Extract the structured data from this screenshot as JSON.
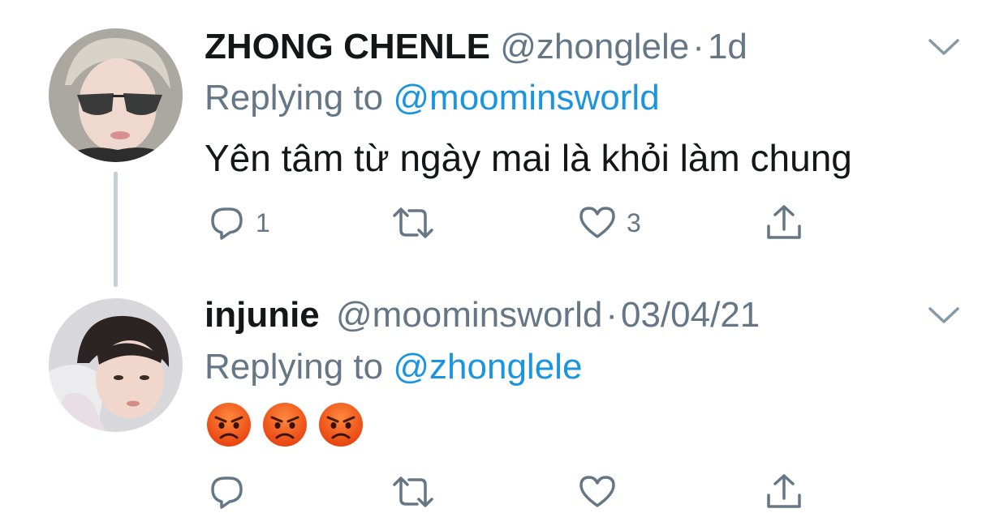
{
  "colors": {
    "text_primary": "#14171a",
    "text_secondary": "#657786",
    "link": "#1b95e0",
    "thread_line": "#c4cfd6"
  },
  "tweets": [
    {
      "display_name": "ZHONG CHENLE",
      "handle": "@zhonglele",
      "separator": "·",
      "time": "1d",
      "replying_prefix": "Replying to",
      "replying_to": "@moominsworld",
      "text": "Yên tâm từ ngày mai là khỏi làm chung",
      "reply_count": "1",
      "retweet_count": "",
      "like_count": "3",
      "avatar_icon": "user-avatar-photo"
    },
    {
      "display_name": "injunie",
      "handle": "@moominsworld",
      "separator": "·",
      "time": "03/04/21",
      "replying_prefix": "Replying to",
      "replying_to": "@zhonglele",
      "emojis": [
        "angry-face-emoji",
        "angry-face-emoji",
        "angry-face-emoji"
      ],
      "reply_count": "",
      "retweet_count": "",
      "like_count": "",
      "avatar_icon": "user-avatar-photo"
    }
  ]
}
